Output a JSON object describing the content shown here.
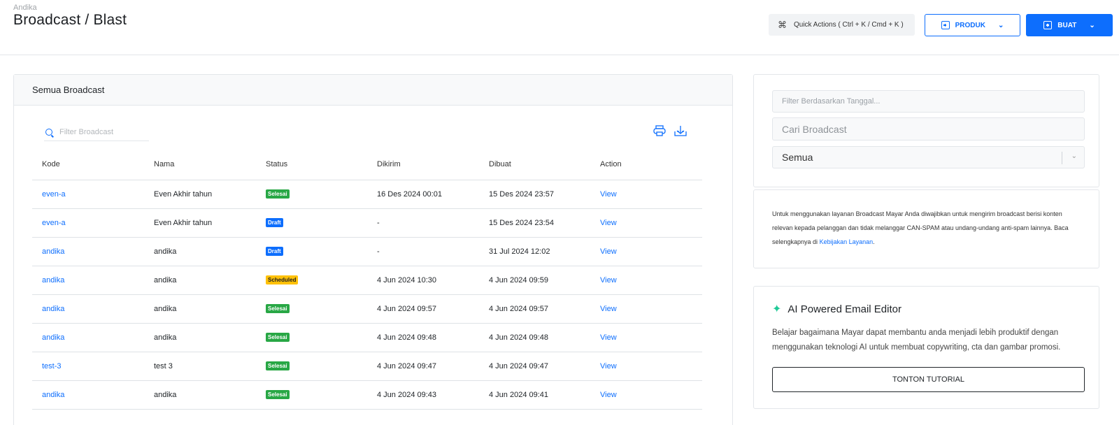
{
  "header": {
    "brand": "Andika",
    "title": "Broadcast / Blast",
    "quick_actions": "Quick Actions ( Ctrl + K / Cmd + K )",
    "produk_label": "PRODUK",
    "buat_label": "BUAT"
  },
  "main": {
    "card_title": "Semua Broadcast",
    "search_placeholder": "Filter Broadcast",
    "columns": [
      "Kode",
      "Nama",
      "Status",
      "Dikirim",
      "Dibuat",
      "Action"
    ],
    "rows": [
      {
        "kode": "even-a",
        "nama": "Even Akhir tahun",
        "status": "Selesai",
        "status_type": "selesai",
        "dikirim": "16 Des 2024 00:01",
        "dibuat": "15 Des 2024 23:57",
        "action": "View"
      },
      {
        "kode": "even-a",
        "nama": "Even Akhir tahun",
        "status": "Draft",
        "status_type": "draft",
        "dikirim": "-",
        "dibuat": "15 Des 2024 23:54",
        "action": "View"
      },
      {
        "kode": "andika",
        "nama": "andika",
        "status": "Draft",
        "status_type": "draft",
        "dikirim": "-",
        "dibuat": "31 Jul 2024 12:02",
        "action": "View"
      },
      {
        "kode": "andika",
        "nama": "andika",
        "status": "Scheduled",
        "status_type": "scheduled",
        "dikirim": "4 Jun 2024 10:30",
        "dibuat": "4 Jun 2024 09:59",
        "action": "View"
      },
      {
        "kode": "andika",
        "nama": "andika",
        "status": "Selesai",
        "status_type": "selesai",
        "dikirim": "4 Jun 2024 09:57",
        "dibuat": "4 Jun 2024 09:57",
        "action": "View"
      },
      {
        "kode": "andika",
        "nama": "andika",
        "status": "Selesai",
        "status_type": "selesai",
        "dikirim": "4 Jun 2024 09:48",
        "dibuat": "4 Jun 2024 09:48",
        "action": "View"
      },
      {
        "kode": "test-3",
        "nama": "test 3",
        "status": "Selesai",
        "status_type": "selesai",
        "dikirim": "4 Jun 2024 09:47",
        "dibuat": "4 Jun 2024 09:47",
        "action": "View"
      },
      {
        "kode": "andika",
        "nama": "andika",
        "status": "Selesai",
        "status_type": "selesai",
        "dikirim": "4 Jun 2024 09:43",
        "dibuat": "4 Jun 2024 09:41",
        "action": "View"
      }
    ]
  },
  "filters": {
    "date_placeholder": "Filter Berdasarkan Tanggal...",
    "search_placeholder": "Cari Broadcast",
    "select_value": "Semua"
  },
  "info": {
    "text": "Untuk menggunakan layanan Broadcast Mayar Anda diwajibkan untuk mengirim broadcast berisi konten relevan kepada pelanggan dan tidak melanggar CAN-SPAM atau undang-undang anti-spam lainnya. Baca selengkapnya di ",
    "link": "Kebijakan Layanan",
    "suffix": "."
  },
  "ai": {
    "title": "AI Powered Email Editor",
    "description": "Belajar bagaimana Mayar dapat membantu anda menjadi lebih produktif dengan menggunakan teknologi AI untuk membuat copywriting, cta dan gambar promosi.",
    "button": "TONTON TUTORIAL"
  },
  "colors": {
    "primary": "#0d6efd",
    "success": "#28a745",
    "warning": "#ffc107",
    "accent": "#20c997"
  }
}
